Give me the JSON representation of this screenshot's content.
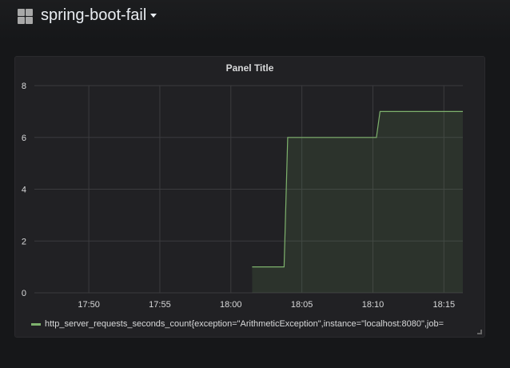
{
  "header": {
    "dashboard_title": "spring-boot-fail",
    "icon": "grid-icon"
  },
  "panel": {
    "title": "Panel Title"
  },
  "chart_data": {
    "type": "area",
    "title": "Panel Title",
    "x_ticks": [
      "17:50",
      "17:55",
      "18:00",
      "18:05",
      "18:10",
      "18:15"
    ],
    "y_ticks": [
      "0",
      "2",
      "4",
      "6",
      "8"
    ],
    "xlim": [
      "17:46:10",
      "18:16:20"
    ],
    "ylim": [
      0,
      8
    ],
    "grid": true,
    "legend_position": "bottom",
    "series": [
      {
        "name": "http_server_requests_seconds_count{exception=\"ArithmeticException\",instance=\"localhost:8080\",job=",
        "color": "#7eb26d",
        "points": [
          [
            "18:01:30",
            1
          ],
          [
            "18:03:45",
            1
          ],
          [
            "18:04:00",
            6
          ],
          [
            "18:10:15",
            6
          ],
          [
            "18:10:30",
            7
          ],
          [
            "18:16:20",
            7
          ]
        ]
      }
    ]
  }
}
